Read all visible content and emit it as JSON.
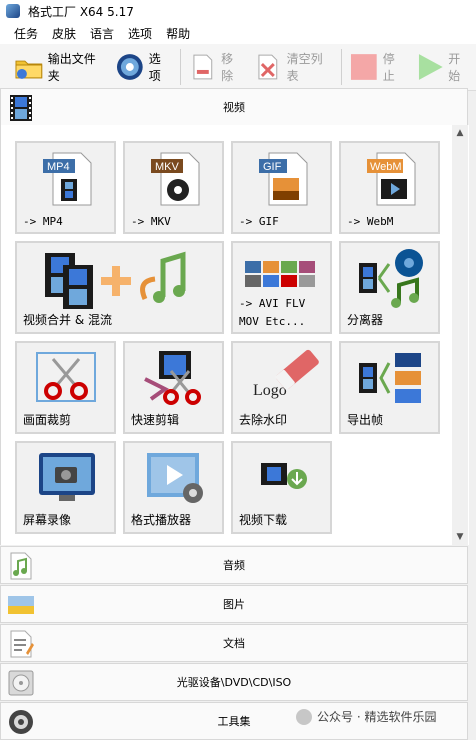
{
  "window": {
    "title": "格式工厂 X64 5.17"
  },
  "menu": [
    "任务",
    "皮肤",
    "语言",
    "选项",
    "帮助"
  ],
  "toolbar": {
    "output_folder": "输出文件夹",
    "options": "选项",
    "remove": "移除",
    "clear_list": "清空列表",
    "stop": "停止",
    "start": "开始"
  },
  "sections": {
    "video": "视频",
    "audio": "音频",
    "image": "图片",
    "document": "文档",
    "disc": "光驱设备\\DVD\\CD\\ISO",
    "tools": "工具集"
  },
  "tiles": {
    "mp4": "-> MP4",
    "mkv": "-> MKV",
    "gif": "-> GIF",
    "webm": "-> WebM",
    "merge": "视频合并 & 混流",
    "avi_line1": "-> AVI FLV",
    "avi_line2": "MOV Etc...",
    "splitter": "分离器",
    "crop": "画面裁剪",
    "quick_cut": "快速剪辑",
    "remove_watermark": "去除水印",
    "export_frames": "导出帧",
    "screen_record": "屏幕录像",
    "player": "格式播放器",
    "download": "视频下载"
  },
  "icon_text": {
    "mp4": "MP4",
    "mkv": "MKV",
    "gif": "GIF",
    "webm": "WebM",
    "logo": "Logo"
  },
  "watermark": "公众号 · 精选软件乐园",
  "icons": {
    "output_folder": "folder-icon",
    "options": "gear-icon",
    "remove": "remove-icon",
    "clear_list": "clear-icon",
    "stop": "stop-icon",
    "start": "play-icon"
  }
}
